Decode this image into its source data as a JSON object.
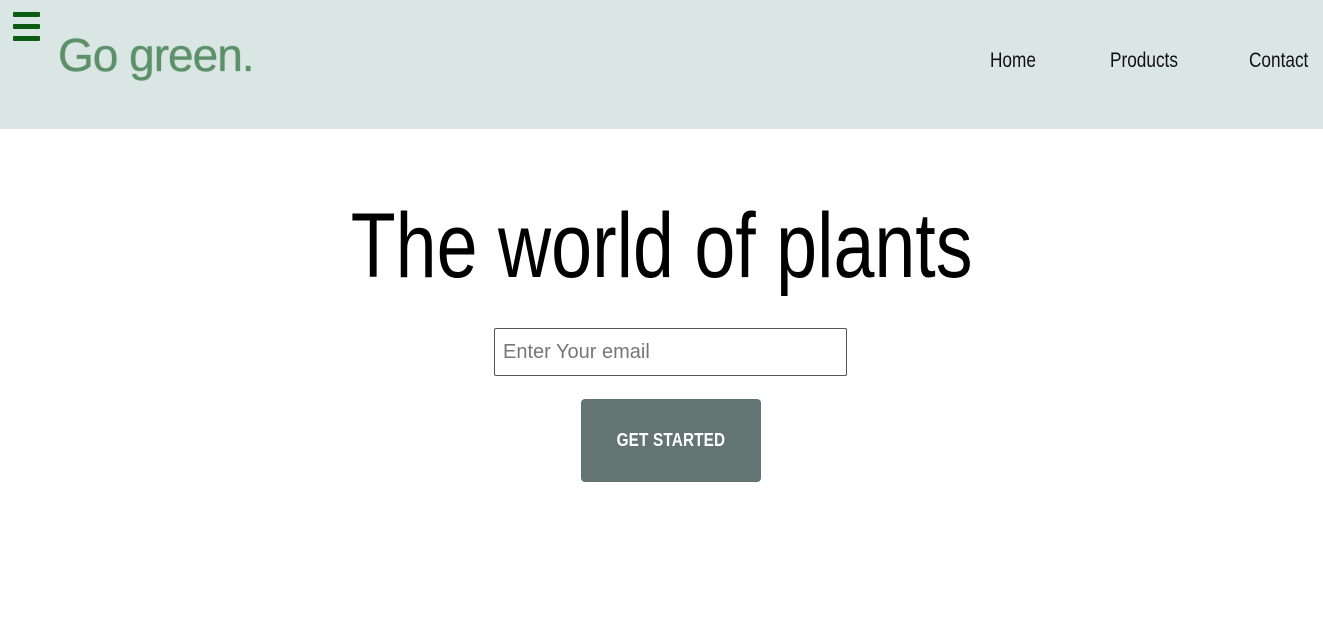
{
  "header": {
    "brand": "Go green.",
    "menu_icon": "hamburger-menu-icon",
    "nav": [
      {
        "label": "Home"
      },
      {
        "label": "Products"
      },
      {
        "label": "Contact"
      }
    ]
  },
  "hero": {
    "title": "The world of plants",
    "email_placeholder": "Enter Your email",
    "email_value": "",
    "cta_label": "GET STARTED"
  },
  "colors": {
    "header_bg": "#dae6e4",
    "brand": "#5b9068",
    "menu_icon": "#0b5c12",
    "cta_bg": "#627572"
  }
}
